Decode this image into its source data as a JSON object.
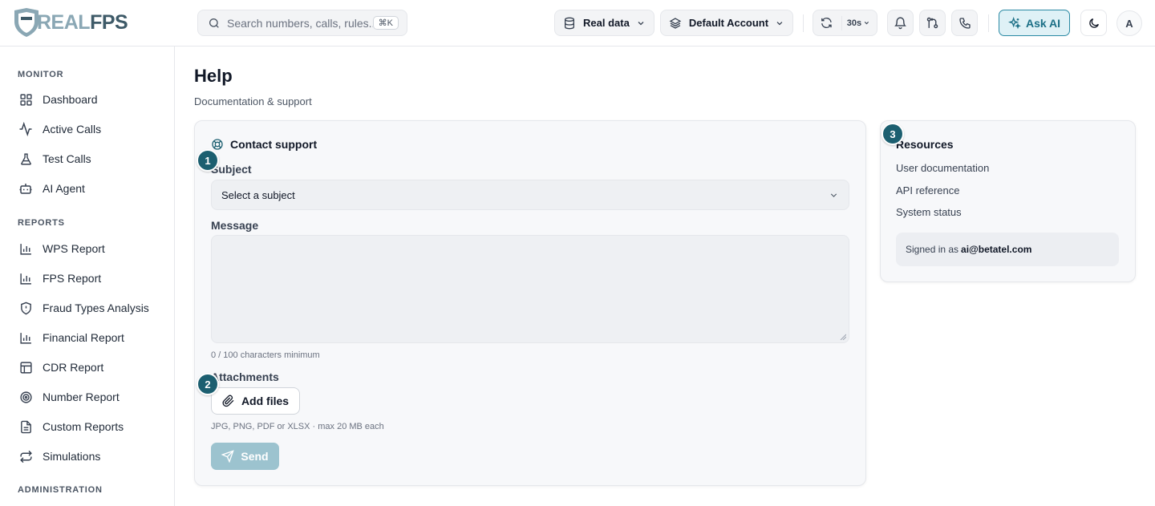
{
  "brand": {
    "part1": "REAL",
    "part2": "FPS"
  },
  "search": {
    "placeholder": "Search numbers, calls, rules...",
    "shortcut": "⌘K"
  },
  "toolbar": {
    "data_source": "Real data",
    "account": "Default Account",
    "refresh_interval": "30s",
    "ask_ai": "Ask AI",
    "avatar_initial": "A"
  },
  "sidebar": {
    "sections": [
      {
        "title": "MONITOR",
        "items": [
          "Dashboard",
          "Active Calls",
          "Test Calls",
          "AI Agent"
        ]
      },
      {
        "title": "REPORTS",
        "items": [
          "WPS Report",
          "FPS Report",
          "Fraud Types Analysis",
          "Financial Report",
          "CDR Report",
          "Number Report",
          "Custom Reports",
          "Simulations"
        ]
      },
      {
        "title": "ADMINISTRATION",
        "items": []
      }
    ]
  },
  "page": {
    "title": "Help",
    "subtitle": "Documentation & support"
  },
  "contact": {
    "title": "Contact support",
    "subject_label": "Subject",
    "subject_value": "Select a subject",
    "message_label": "Message",
    "message_value": "",
    "char_hint": "0 / 100 characters minimum",
    "attachments_label": "Attachments",
    "add_files": "Add files",
    "file_hint": "JPG, PNG, PDF or XLSX · max 20 MB each",
    "send": "Send"
  },
  "resources": {
    "title": "Resources",
    "links": [
      "User documentation",
      "API reference",
      "System status"
    ],
    "signed_in_prefix": "Signed in as",
    "signed_in_email": "ai@betatel.com"
  },
  "badges": [
    "1",
    "2",
    "3"
  ],
  "colors": {
    "accent": "#1c5f70",
    "ask_ai_bg": "#dff1f6",
    "send_disabled": "#9cc3cf"
  }
}
